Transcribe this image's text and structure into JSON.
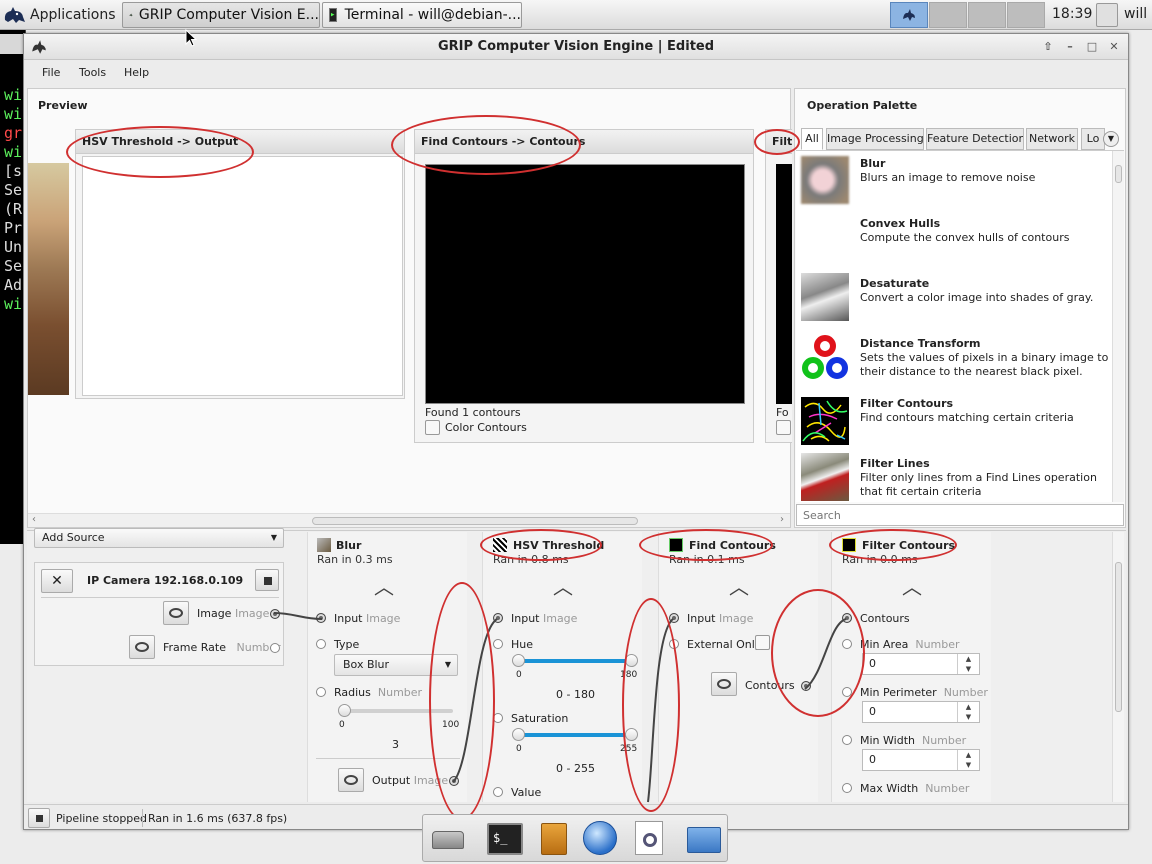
{
  "taskbar": {
    "applications": "Applications",
    "tasks": [
      "GRIP Computer Vision E...",
      "Terminal - will@debian-..."
    ],
    "clock": "18:39",
    "user": "will"
  },
  "terminal_lines": [
    {
      "text": "wi",
      "color": "#5cf05c"
    },
    {
      "text": "wi",
      "color": "#5cf05c"
    },
    {
      "text": "gr",
      "color": "#ff4a4a"
    },
    {
      "text": "wi",
      "color": "#5cf05c"
    },
    {
      "text": "[s",
      "color": "#dddddd"
    },
    {
      "text": "Se",
      "color": "#dddddd"
    },
    {
      "text": "(R",
      "color": "#dddddd"
    },
    {
      "text": "Pr",
      "color": "#dddddd"
    },
    {
      "text": "Un",
      "color": "#dddddd"
    },
    {
      "text": "Se",
      "color": "#dddddd"
    },
    {
      "text": "Ad",
      "color": "#dddddd"
    },
    {
      "text": "wi",
      "color": "#5cf05c"
    }
  ],
  "window": {
    "title": "GRIP Computer Vision Engine | Edited",
    "menu": [
      "File",
      "Tools",
      "Help"
    ]
  },
  "preview": {
    "title": "Preview",
    "cards": [
      {
        "title": "HSV Threshold -> Output"
      },
      {
        "title": "Find Contours -> Contours",
        "status": "Found 1 contours",
        "checkbox": "Color Contours"
      },
      {
        "title": "Filte",
        "status": "Fo"
      }
    ]
  },
  "palette": {
    "title": "Operation Palette",
    "tabs": [
      "All",
      "Image Processing",
      "Feature Detection",
      "Network",
      "Lo"
    ],
    "search_placeholder": "Search",
    "ops": [
      {
        "name": "Blur",
        "desc": "Blurs an image to remove noise"
      },
      {
        "name": "Convex Hulls",
        "desc": "Compute the convex hulls of contours"
      },
      {
        "name": "Desaturate",
        "desc": "Convert a color image into shades of gray."
      },
      {
        "name": "Distance Transform",
        "desc": "Sets the values of pixels in a binary image to their distance to the nearest black pixel."
      },
      {
        "name": "Filter Contours",
        "desc": "Find contours matching certain criteria"
      },
      {
        "name": "Filter Lines",
        "desc": "Filter only lines from a Find Lines operation that fit certain criteria"
      }
    ]
  },
  "source": {
    "add_source": "Add Source",
    "camera": "IP Camera 192.168.0.109",
    "outputs": [
      {
        "label": "Image",
        "type": "Image"
      },
      {
        "label": "Frame Rate",
        "type": "Number"
      }
    ]
  },
  "steps": {
    "blur": {
      "title": "Blur",
      "time": "Ran in 0.3 ms",
      "input": "Input",
      "input_type": "Image",
      "type_label": "Type",
      "type_value": "Box Blur",
      "radius": "Radius",
      "radius_type": "Number",
      "radius_min": "0",
      "radius_max": "100",
      "radius_value": "3",
      "radius_fraction": 0.03,
      "output": "Output",
      "output_type": "Image"
    },
    "hsv": {
      "title": "HSV Threshold",
      "time": "Ran in 0.8 ms",
      "input": "Input",
      "input_type": "Image",
      "hue": "Hue",
      "hue_min": "0",
      "hue_max": "180",
      "hue_range": "0 - 180",
      "sat": "Saturation",
      "sat_min": "0",
      "sat_max": "255",
      "sat_range": "0 - 255",
      "value": "Value"
    },
    "contours": {
      "title": "Find Contours",
      "time": "Ran in 0.1 ms",
      "input": "Input",
      "input_type": "Image",
      "external": "External Only",
      "output": "Contours"
    },
    "filter": {
      "title": "Filter Contours",
      "time": "Ran in 0.0 ms",
      "contours": "Contours",
      "min_area": "Min Area",
      "min_area_type": "Number",
      "min_area_value": "0",
      "min_perim": "Min Perimeter",
      "min_perim_type": "Number",
      "min_perim_value": "0",
      "min_width": "Min Width",
      "min_width_type": "Number",
      "min_width_value": "0",
      "max_width": "Max Width",
      "max_width_type": "Number"
    }
  },
  "status": {
    "state": "Pipeline stopped",
    "ran": "Ran in 1.6 ms (637.8 fps)"
  }
}
